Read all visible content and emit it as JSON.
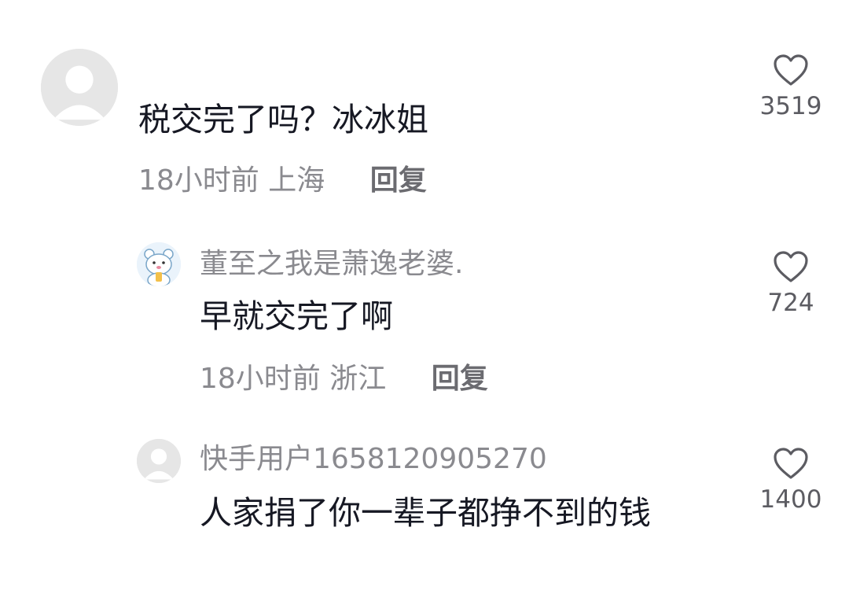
{
  "comments": [
    {
      "username": "",
      "text": "税交完了吗？冰冰姐",
      "time": "18小时前",
      "location": "上海",
      "reply_label": "回复",
      "likes": "3519",
      "avatar_icon": "default-user-avatar-icon"
    },
    {
      "username": "董至之我是萧逸老婆.",
      "text": "早就交完了啊",
      "time": "18小时前",
      "location": "浙江",
      "reply_label": "回复",
      "likes": "724",
      "avatar_icon": "cartoon-bear-avatar-icon"
    },
    {
      "username": "快手用户1658120905270",
      "text": "人家捐了你一辈子都挣不到的钱",
      "time": "",
      "location": "",
      "reply_label": "",
      "likes": "1400",
      "avatar_icon": "default-user-avatar-icon"
    }
  ],
  "colors": {
    "primary_text": "#161823",
    "secondary_text": "#8a8a8f",
    "like_outline": "#5c5c62",
    "avatar_bg": "#e8e8e8"
  }
}
